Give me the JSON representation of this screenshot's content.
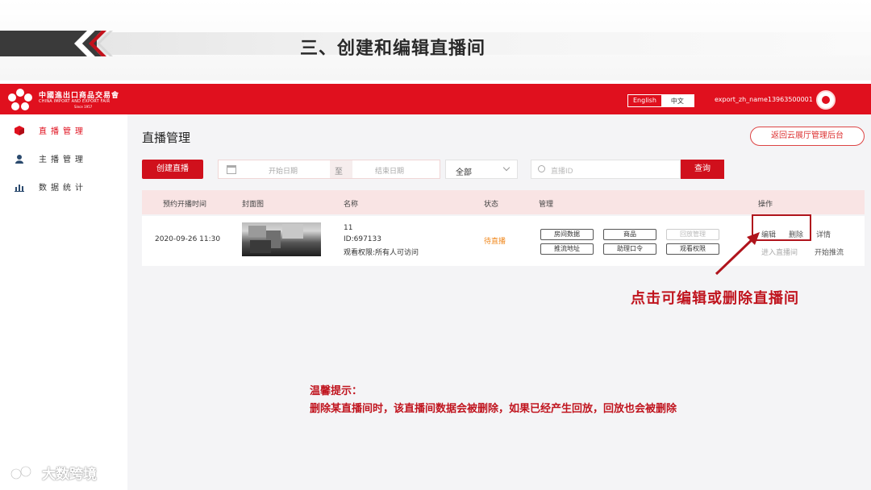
{
  "slide": {
    "title": "三、创建和编辑直播间",
    "callout": "点击可编辑或删除直播间",
    "tip_title": "温馨提示：",
    "tip_body": "删除某直播间时，该直播间数据会被删除，如果已经产生回放，回放也会被删除",
    "watermark": "大数跨境"
  },
  "header": {
    "logo_cn": "中國進出口商品交易會",
    "logo_en": "CHINA IMPORT AND EXPORT FAIR",
    "logo_since": "Since 1957",
    "lang_en": "English",
    "lang_zh": "中文",
    "username": "export_zh_name13963500001"
  },
  "sidebar": {
    "items": [
      {
        "label": "直播管理",
        "icon": "cube-icon",
        "active": true
      },
      {
        "label": "主播管理",
        "icon": "user-icon",
        "active": false
      },
      {
        "label": "数据统计",
        "icon": "bar-chart-icon",
        "active": false
      }
    ]
  },
  "page": {
    "title": "直播管理",
    "back_button": "返回云展厅管理后台",
    "create_button": "创建直播",
    "date_start_placeholder": "开始日期",
    "date_sep": "至",
    "date_end_placeholder": "结束日期",
    "select_value": "全部",
    "search_placeholder": "直播ID",
    "query_button": "查询"
  },
  "table": {
    "headers": [
      "预约开播时间",
      "封面图",
      "名称",
      "状态",
      "管理",
      "操作"
    ],
    "rows": [
      {
        "time": "2020-09-26 11:30",
        "name": "11",
        "id": "ID:697133",
        "permission": "观看权限:所有人可访问",
        "status": "待直播",
        "manage": [
          "房间数据",
          "商品",
          "回放管理",
          "推流地址",
          "助理口令",
          "观看权限"
        ],
        "ops": {
          "edit": "编辑",
          "delete": "删除",
          "detail": "详情",
          "enter": "进入直播间",
          "push": "开始推流"
        }
      }
    ]
  },
  "colors": {
    "brand": "#e0101e",
    "accent": "#c0141e",
    "status": "#f0881e"
  }
}
